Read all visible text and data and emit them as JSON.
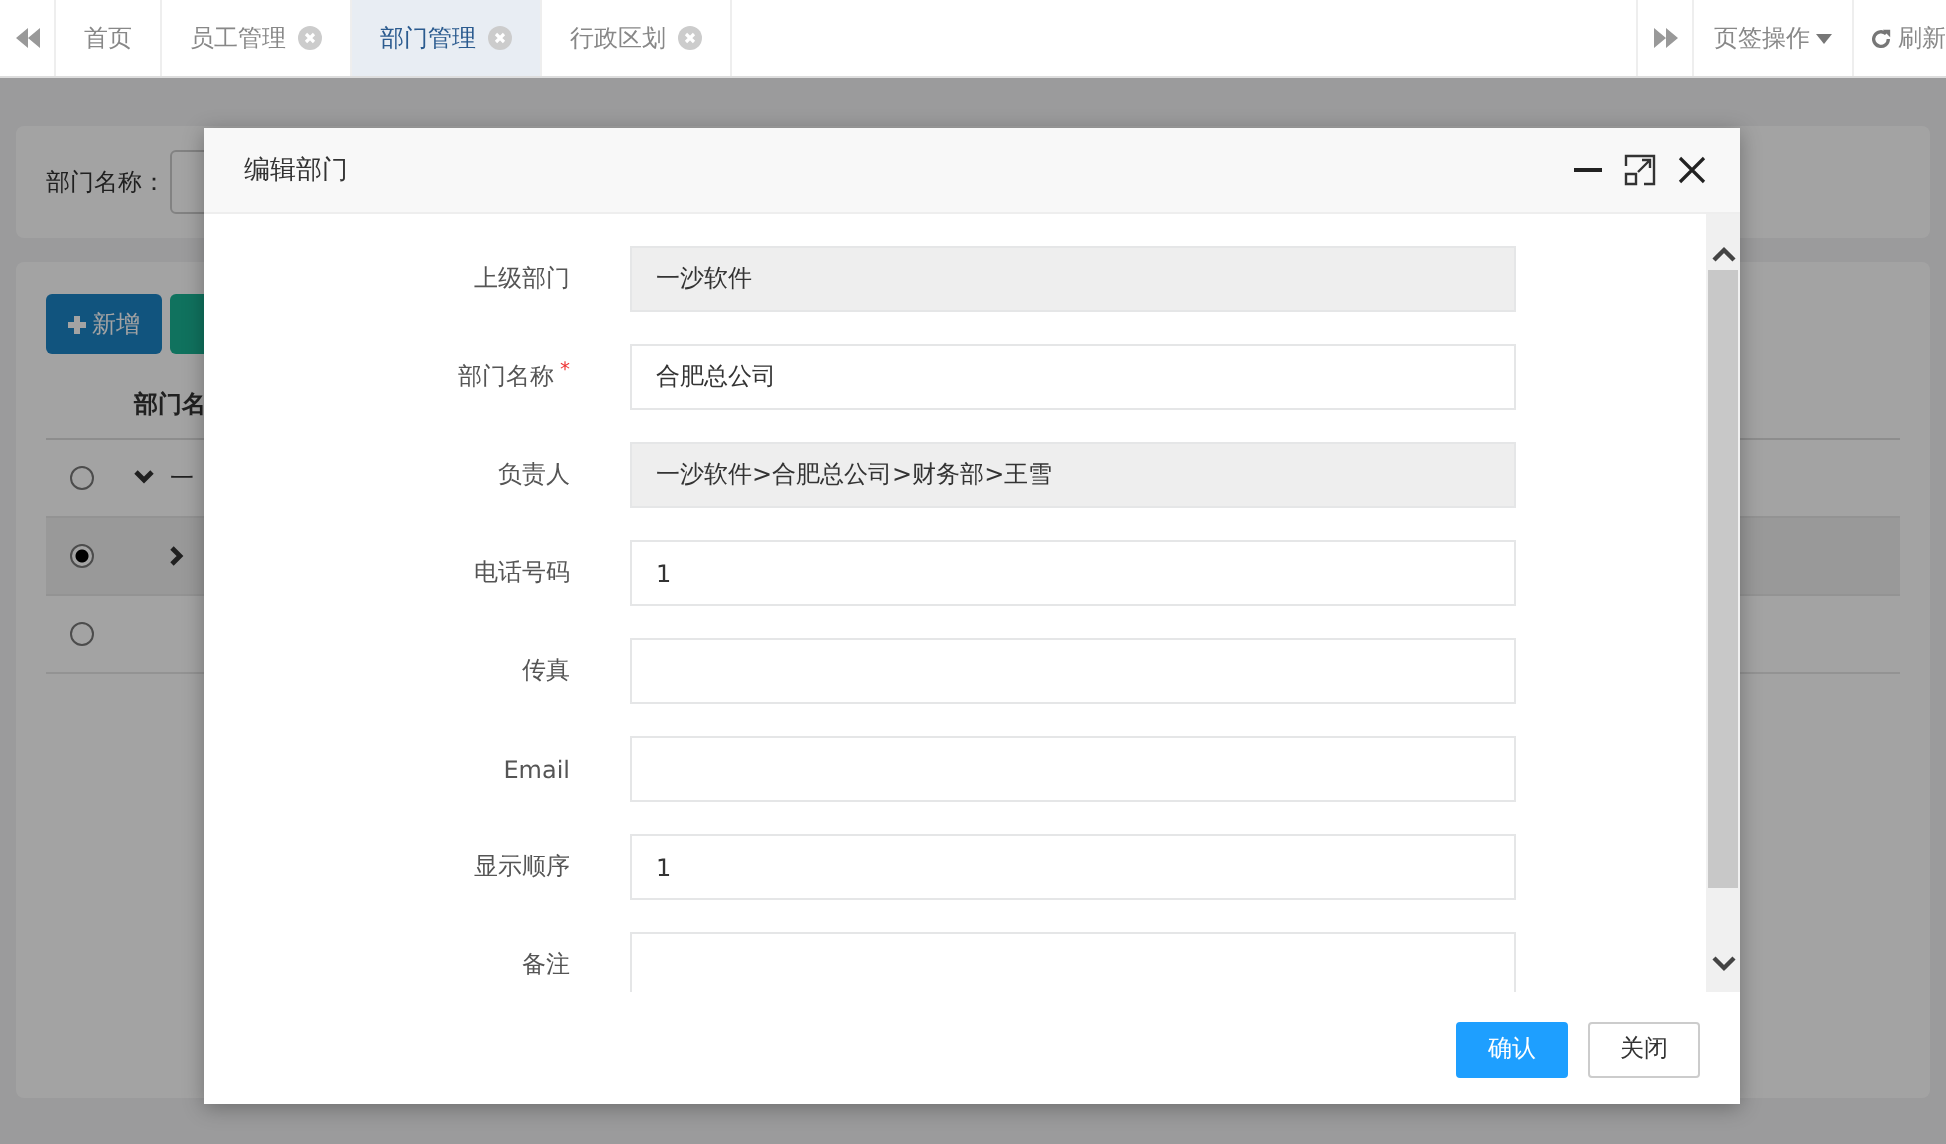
{
  "tab_bar": {
    "tabs": [
      {
        "label": "首页",
        "closable": false,
        "selected": false
      },
      {
        "label": "员工管理",
        "closable": true,
        "selected": false
      },
      {
        "label": "部门管理",
        "closable": true,
        "selected": true
      },
      {
        "label": "行政区划",
        "closable": true,
        "selected": false
      }
    ],
    "tab_actions": "页签操作",
    "refresh": "刷新"
  },
  "search": {
    "label": "部门名称："
  },
  "toolbar": {
    "add_button": "新增"
  },
  "table": {
    "header": "部门名",
    "rows": [
      {
        "selected": false,
        "expanded": true,
        "name": "一"
      },
      {
        "selected": true,
        "expanded": false
      },
      {
        "selected": false
      }
    ]
  },
  "dialog": {
    "title": "编辑部门",
    "fields": [
      {
        "label": "上级部门",
        "kind": "readonly",
        "value": "一沙软件"
      },
      {
        "label": "部门名称",
        "kind": "input",
        "value": "合肥总公司",
        "required_mark": "*"
      },
      {
        "label": "负责人",
        "kind": "readonly",
        "value": "一沙软件>合肥总公司>财务部>王雪"
      },
      {
        "label": "电话号码",
        "kind": "input",
        "value": "1"
      },
      {
        "label": "传真",
        "kind": "input"
      },
      {
        "label": "Email",
        "kind": "input"
      },
      {
        "label": "显示顺序",
        "kind": "input",
        "value": "1"
      },
      {
        "label": "备注",
        "kind": "textarea"
      }
    ],
    "buttons": [
      {
        "label": "确认",
        "kind": "primary"
      },
      {
        "label": "关闭",
        "kind": "default"
      }
    ]
  }
}
